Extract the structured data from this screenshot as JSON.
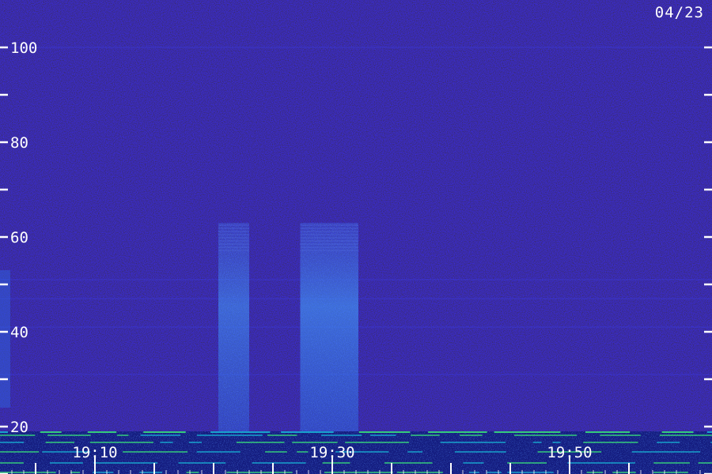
{
  "chart_data": {
    "type": "heatmap",
    "date": "04/23",
    "y_ticks": [
      100,
      80,
      60,
      40,
      20
    ],
    "y_minor_ticks": [
      90,
      70,
      50,
      30,
      10
    ],
    "ylim": [
      10,
      110
    ],
    "x_ticks": [
      {
        "t": 10,
        "label": "19:10"
      },
      {
        "t": 30,
        "label": "19:30"
      },
      {
        "t": 50,
        "label": "19:50"
      }
    ],
    "x_minor_ticks": [
      5,
      15,
      20,
      25,
      35,
      40,
      45,
      55
    ],
    "xlim": [
      2,
      62
    ],
    "bursts": [
      {
        "t_start": 20.4,
        "t_end": 23.0,
        "f_low": 19,
        "f_high": 63,
        "intensity": 0.6
      },
      {
        "t_start": 27.3,
        "t_end": 32.2,
        "f_low": 19,
        "f_high": 63,
        "intensity": 0.7
      }
    ],
    "left_edge_band": {
      "f_low": 24,
      "f_high": 53
    },
    "horizontal_lines": [
      100,
      51,
      47,
      41,
      31
    ],
    "colors": {
      "background": "#140a62",
      "noise_dark": "#07022e",
      "noise_light": "#2a1cc4",
      "burst": "#2f6fe0",
      "burst_core": "#4fa6ff",
      "low_band": "#00a6c8",
      "low_band_green": "#39e87a",
      "axis": "#ffffff"
    }
  }
}
